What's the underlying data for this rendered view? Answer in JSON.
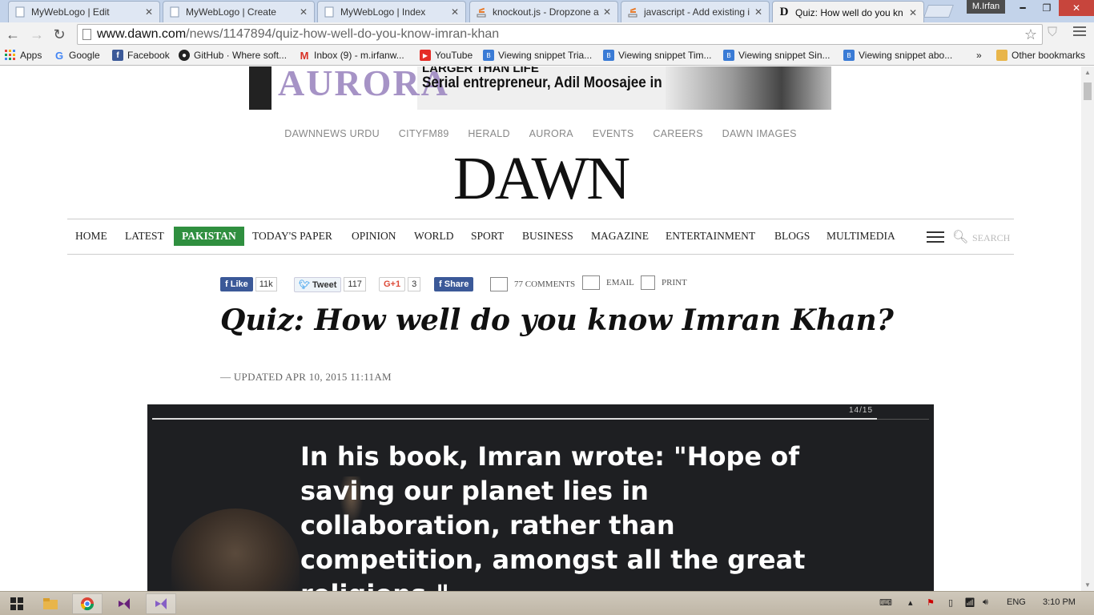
{
  "browser": {
    "tabs": [
      {
        "title": "MyWebLogo | Edit",
        "icon": "page-icon"
      },
      {
        "title": "MyWebLogo | Create",
        "icon": "page-icon"
      },
      {
        "title": "MyWebLogo | Index",
        "icon": "page-icon"
      },
      {
        "title": "knockout.js - Dropzone a",
        "icon": "stackoverflow-icon"
      },
      {
        "title": "javascript - Add existing i",
        "icon": "stackoverflow-icon"
      },
      {
        "title": "Quiz: How well do you kn",
        "icon": "dawn-icon"
      }
    ],
    "user": "M.Irfan",
    "url_host": "www.dawn.com",
    "url_path": "/news/1147894/quiz-how-well-do-you-know-imran-khan",
    "bookmarks": [
      {
        "label": "Apps"
      },
      {
        "label": "Google"
      },
      {
        "label": "Facebook"
      },
      {
        "label": "GitHub · Where soft..."
      },
      {
        "label": "Inbox (9) - m.irfanw..."
      },
      {
        "label": "YouTube"
      },
      {
        "label": "Viewing snippet Tria..."
      },
      {
        "label": "Viewing snippet Tim..."
      },
      {
        "label": "Viewing snippet Sin..."
      },
      {
        "label": "Viewing snippet abo..."
      }
    ],
    "overflow": "»",
    "other_bookmarks": "Other bookmarks"
  },
  "page": {
    "banner": {
      "brand": "AURORA",
      "line1": "LARGER THAN LIFE",
      "line2": "Serial entrepreneur, Adil Moosajee in profile"
    },
    "network_links": [
      "DAWNNEWS URDU",
      "CITYFM89",
      "HERALD",
      "AURORA",
      "EVENTS",
      "CAREERS",
      "DAWN IMAGES"
    ],
    "masthead": "DAWN",
    "nav": [
      "HOME",
      "LATEST",
      "PAKISTAN",
      "TODAY'S PAPER",
      "OPINION",
      "WORLD",
      "SPORT",
      "BUSINESS",
      "MAGAZINE",
      "ENTERTAINMENT",
      "BLOGS",
      "MULTIMEDIA"
    ],
    "nav_active": "PAKISTAN",
    "search_placeholder": "SEARCH",
    "share": {
      "like": "Like",
      "like_count": "11k",
      "tweet": "Tweet",
      "tweet_count": "117",
      "gplus": "G+1",
      "gplus_count": "3",
      "share": "Share",
      "comments": "77 COMMENTS",
      "email": "EMAIL",
      "print": "PRINT"
    },
    "headline": "Quiz: How well do you know Imran Khan?",
    "updated": "— UPDATED APR 10, 2015 11:11AM",
    "quiz": {
      "counter": "14/15",
      "progress": 0.933,
      "question": "In his book, Imran wrote: \"Hope of saving our planet lies in collaboration, rather than competition, amongst all the great religions.\""
    }
  },
  "taskbar": {
    "language": "ENG",
    "time": "3:10 PM"
  },
  "colors": {
    "nav_active": "#2f8f3f",
    "facebook": "#3b5998",
    "quiz_bg": "#1e1f22"
  }
}
